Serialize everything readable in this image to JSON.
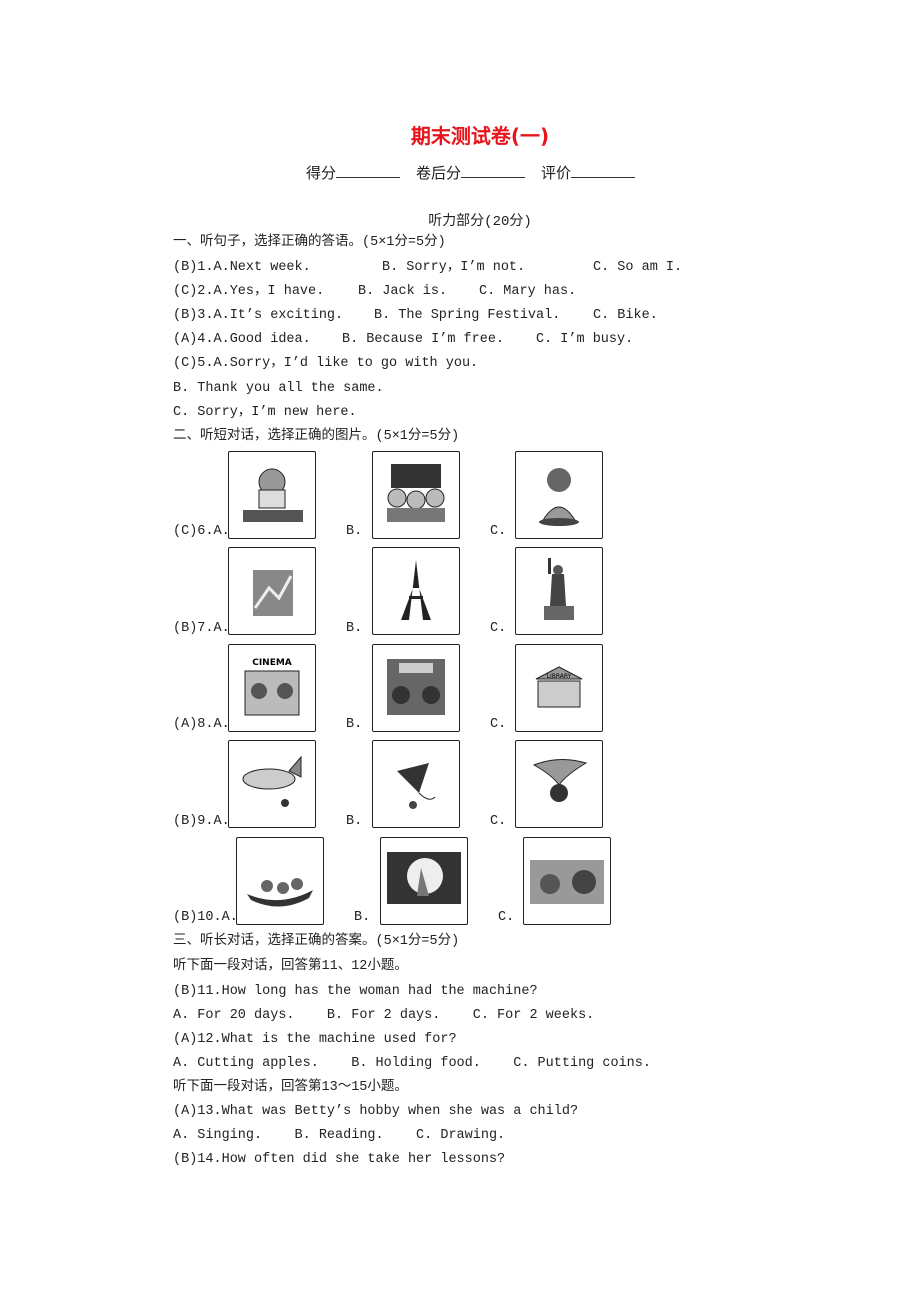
{
  "title": "期末测试卷(一)",
  "score_fields": [
    "得分",
    "卷后分",
    "评价"
  ],
  "section_heading": "听力部分(20分)",
  "part1": {
    "heading": "一、听句子，选择正确的答语。(5×1分=5分)",
    "lines": [
      {
        "q": "(B)1.A.Next week.",
        "b": "B. Sorry，I’m not.",
        "c": "C. So am I."
      },
      {
        "q": "(C)2.A.Yes，I have.",
        "b": "B. Jack is.",
        "c": "C. Mary has."
      },
      {
        "q": "(B)3.A.It’s exciting.",
        "b": "B. The Spring Festival.",
        "c": "C. Bike."
      },
      {
        "q": "(A)4.A.Good idea.",
        "b": "B. Because I’m free.",
        "c": "C. I’m busy."
      },
      {
        "q": "(C)5.A.Sorry，I’d like to go with you.",
        "b": "",
        "c": ""
      }
    ],
    "extra": [
      "B. Thank you all the same.",
      "C. Sorry，I’m new here."
    ]
  },
  "part2": {
    "heading": "二、听短对话，选择正确的图片。(5×1分=5分)",
    "rows": [
      {
        "q": "(C)6.A.",
        "b": "B.",
        "c": "C."
      },
      {
        "q": "(B)7.A.",
        "b": "B.",
        "c": "C."
      },
      {
        "q": "(A)8.A.",
        "b": "B.",
        "c": "C."
      },
      {
        "q": "(B)9.A.",
        "b": "B.",
        "c": "C."
      },
      {
        "q": "(B)10.A.",
        "b": "B.",
        "c": "C."
      }
    ],
    "picture_text": {
      "cinema": "CINEMA",
      "library": "LIBRARY"
    }
  },
  "part3": {
    "heading": "三、听长对话，选择正确的答案。(5×1分=5分)",
    "lines": [
      "听下面一段对话，回答第11、12小题。",
      "(B)11.How long has the woman had the machine?",
      "A. For 20 days.    B. For 2 days.    C. For 2 weeks.",
      "(A)12.What is the machine used for?",
      "A. Cutting apples.    B. Holding food.    C. Putting coins.",
      "听下面一段对话，回答第13～15小题。",
      "(A)13.What was Betty’s hobby when she was a child?",
      "A. Singing.    B. Reading.    C. Drawing.",
      "(B)14.How often did she take her lessons?"
    ]
  }
}
